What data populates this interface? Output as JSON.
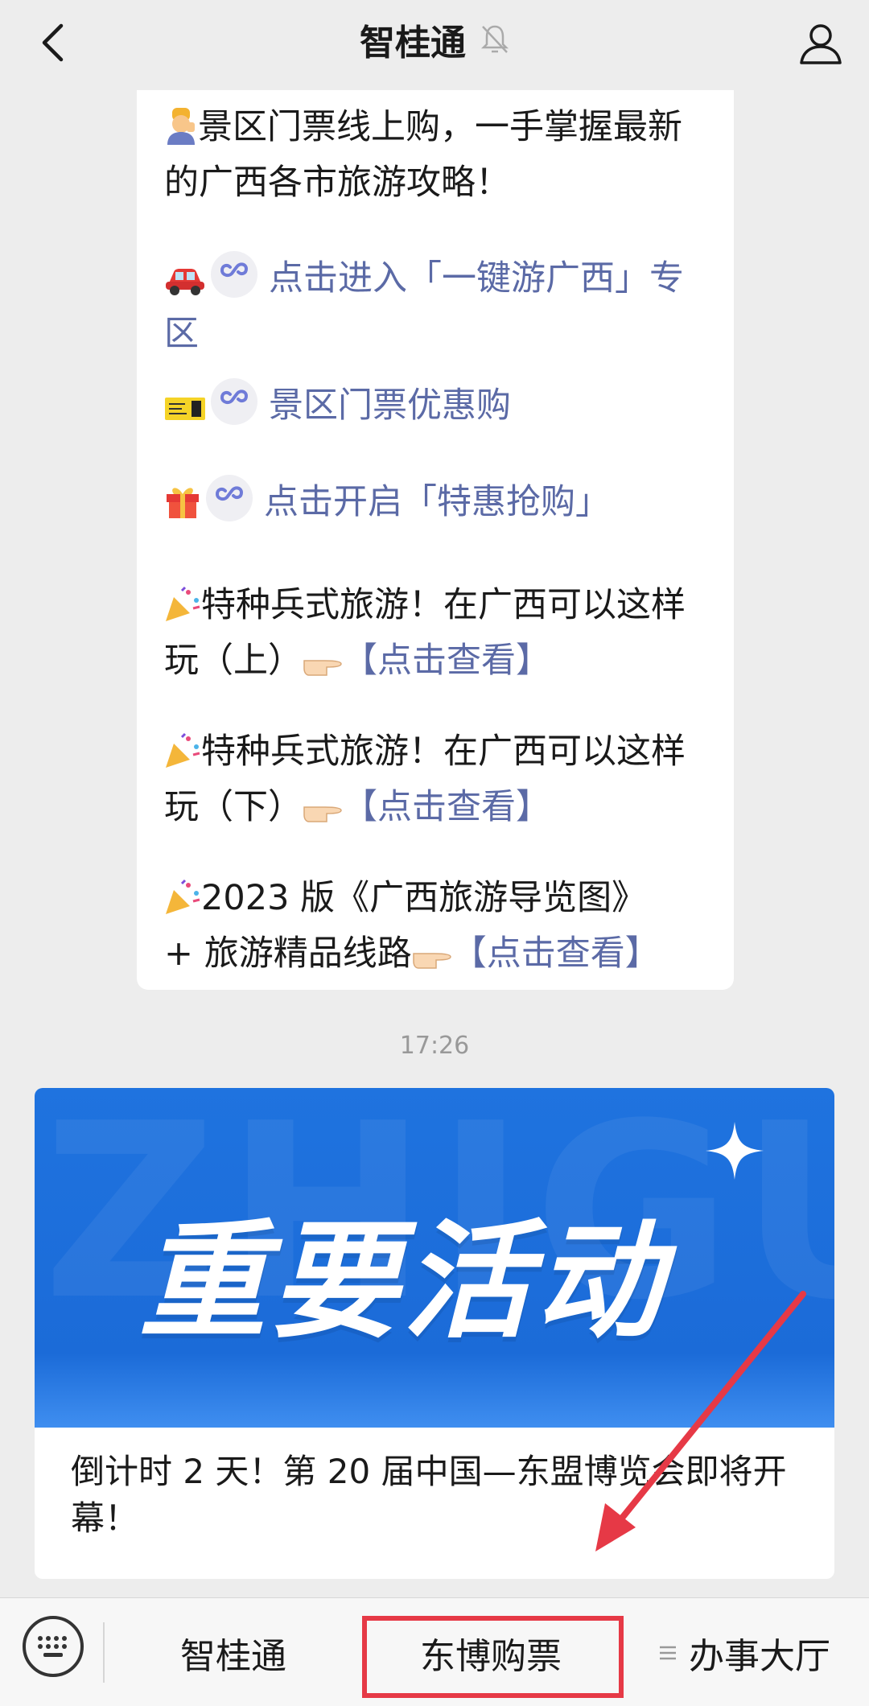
{
  "header": {
    "title": "智桂通"
  },
  "message": {
    "intro_l1": "景区门票线上购，一手掌握最新",
    "intro_l2": "的广西各市旅游攻略！",
    "link1_l1": "点击进入「一键游广西」专",
    "link1_l2": "区",
    "link2": "景区门票优惠购",
    "link3": "点击开启「特惠抢购」",
    "item1_l1": "特种兵式旅游！在广西可以这样",
    "item1_l2": "玩（上）",
    "item1_link": "【点击查看】",
    "item2_l1": "特种兵式旅游！在广西可以这样",
    "item2_l2": "玩（下）",
    "item2_link": "【点击查看】",
    "item3_l1": "2023 版《广西旅游导览图》",
    "item3_l2": "+ 旅游精品线路",
    "item3_link": "【点击查看】"
  },
  "timestamp": "17:26",
  "article": {
    "banner_title": "重要活动",
    "banner_bg_text": "ZHIGUI",
    "title": "倒计时 2 天！第 20 届中国—东盟博览会即将开幕！"
  },
  "bottom_menu": {
    "item1": "智桂通",
    "item2": "东博购票",
    "item3": "办事大厅"
  },
  "colors": {
    "link": "#5b6aa6",
    "banner": "#1f73df",
    "annotation": "#e63946"
  }
}
